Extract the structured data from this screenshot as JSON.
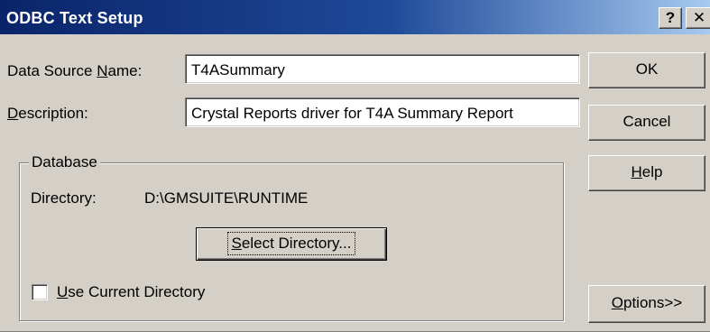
{
  "window": {
    "title": "ODBC Text Setup",
    "help_glyph": "?",
    "close_glyph": "✕"
  },
  "fields": {
    "dsn_label_pre": "Data Source ",
    "dsn_label_mnemonic": "N",
    "dsn_label_post": "ame:",
    "dsn_value": "T4ASummary",
    "desc_label_mnemonic": "D",
    "desc_label_post": "escription:",
    "desc_value": "Crystal Reports driver for T4A Summary Report"
  },
  "database": {
    "group_label": "Database",
    "directory_label": "Directory:",
    "directory_value": "D:\\GMSUITE\\RUNTIME",
    "select_dir_mnemonic": "S",
    "select_dir_post": "elect Directory...",
    "use_current_mnemonic": "U",
    "use_current_post": "se Current Directory",
    "use_current_checked": false
  },
  "buttons": {
    "ok": "OK",
    "cancel": "Cancel",
    "help_mnemonic": "H",
    "help_post": "elp",
    "options_mnemonic": "O",
    "options_post": "ptions>>"
  },
  "colors": {
    "face": "#d4d0c8",
    "title_start": "#0a246a",
    "title_end": "#a6caf0"
  }
}
